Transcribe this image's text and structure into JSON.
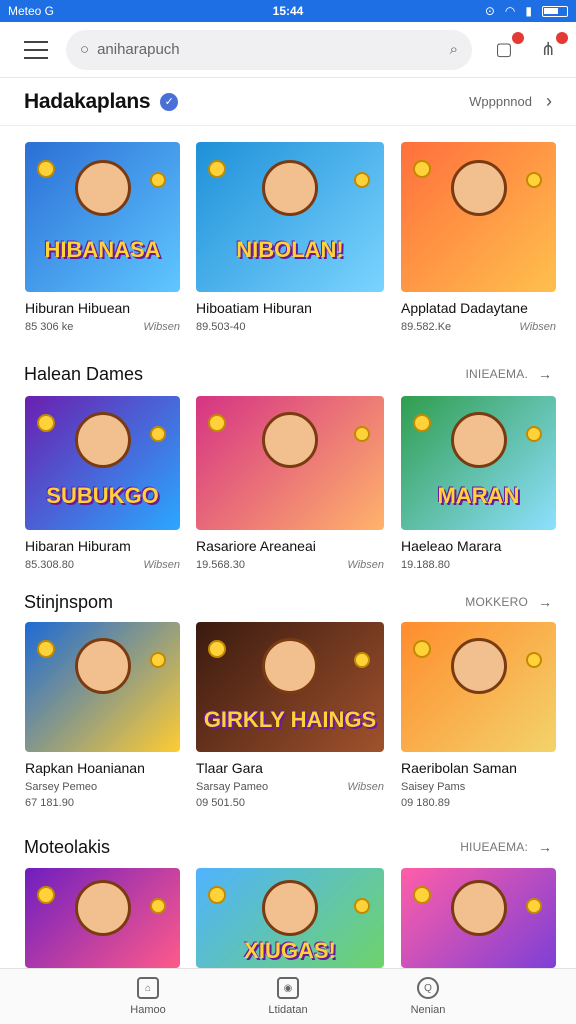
{
  "status": {
    "carrier": "Meteo G",
    "time": "15:44"
  },
  "search": {
    "placeholder": "aniharapuch"
  },
  "feature": {
    "title": "Hadakaplans",
    "link": "Wpppnnod"
  },
  "sections": [
    {
      "title": "",
      "link": "",
      "cards": [
        {
          "thumb_label": "HIBANASA",
          "name": "Hiburan Hibuean",
          "meta_left": "85 306 ke",
          "meta_right": "Wibsen",
          "sub": "",
          "colors": [
            "#2b6fd6",
            "#5fc7ff"
          ]
        },
        {
          "thumb_label": "NIBOLAN!",
          "name": "Hiboatiam Hiburan",
          "meta_left": "89.503-40",
          "meta_right": "",
          "sub": "",
          "colors": [
            "#1e90d8",
            "#7bd4ff"
          ]
        },
        {
          "thumb_label": "",
          "name": "Applatad Dadaytane",
          "meta_left": "89.582.Ke",
          "meta_right": "Wibsen",
          "sub": "",
          "colors": [
            "#ff6f3c",
            "#ffc04d"
          ]
        }
      ]
    },
    {
      "title": "Halean Dames",
      "link": "INIEAEMA.",
      "cards": [
        {
          "thumb_label": "SUBUKGO",
          "name": "Hibaran Hiburam",
          "meta_left": "85.308.80",
          "meta_right": "Wibsen",
          "sub": "",
          "colors": [
            "#6a1fb0",
            "#2aa8ff"
          ]
        },
        {
          "thumb_label": "",
          "name": "Rasariore Areaneai",
          "meta_left": "19.568.30",
          "meta_right": "Wibsen",
          "sub": "",
          "colors": [
            "#d63384",
            "#ffb36b"
          ]
        },
        {
          "thumb_label": "MARAN",
          "name": "Haeleao Marara",
          "meta_left": "19.188.80",
          "meta_right": "",
          "sub": "",
          "colors": [
            "#2f9d4e",
            "#8ee0ff"
          ]
        }
      ]
    },
    {
      "title": "Stinjnspom",
      "link": "MOKKERO",
      "cards": [
        {
          "thumb_label": "",
          "name": "Rapkan Hoanianan",
          "meta_left": "Sarsey Pemeo",
          "meta_right": "",
          "sub": "67 181.90",
          "colors": [
            "#1c6ad6",
            "#ffcc33"
          ]
        },
        {
          "thumb_label": "GIRKLY HAINGS",
          "name": "Tlaar Gara",
          "meta_left": "Sarsay Pameo",
          "meta_right": "Wibsen",
          "sub": "09 501.50",
          "colors": [
            "#3a1a0f",
            "#a0522d"
          ]
        },
        {
          "thumb_label": "",
          "name": "Raeribolan Saman",
          "meta_left": "Saisey Pams",
          "meta_right": "",
          "sub": "09 180.89",
          "colors": [
            "#ff8c2e",
            "#f3d36b"
          ]
        }
      ]
    },
    {
      "title": "Moteolakis",
      "link": "HIUEAEMA:",
      "cards": [
        {
          "thumb_label": "",
          "name": "",
          "meta_left": "",
          "meta_right": "",
          "sub": "",
          "colors": [
            "#6f1ec0",
            "#ff5a8a"
          ]
        },
        {
          "thumb_label": "XIUGAS!",
          "name": "",
          "meta_left": "",
          "meta_right": "",
          "sub": "",
          "colors": [
            "#4fb3ff",
            "#6fd36b"
          ]
        },
        {
          "thumb_label": "",
          "name": "",
          "meta_left": "",
          "meta_right": "",
          "sub": "",
          "colors": [
            "#ff5ea8",
            "#7e3fd6"
          ]
        }
      ]
    }
  ],
  "nav": [
    {
      "label": "Hamoo"
    },
    {
      "label": "Ltidatan"
    },
    {
      "label": "Nenian"
    }
  ]
}
